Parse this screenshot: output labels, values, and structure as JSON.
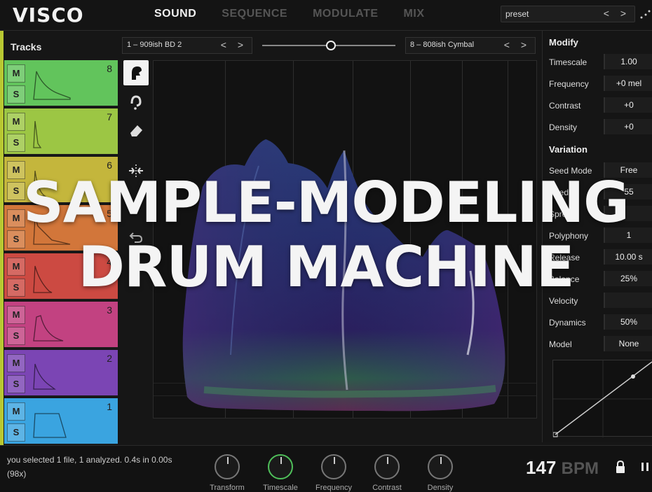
{
  "app": {
    "brand": "VISCO"
  },
  "tabs": [
    {
      "label": "SOUND",
      "active": true
    },
    {
      "label": "SEQUENCE",
      "active": false
    },
    {
      "label": "MODULATE",
      "active": false
    },
    {
      "label": "MIX",
      "active": false
    }
  ],
  "preset": {
    "value": "preset",
    "arrows": "< >"
  },
  "tracks": {
    "title": "Tracks",
    "mute_label": "M",
    "solo_label": "S",
    "items": [
      {
        "number": "8",
        "color": "#62c45c"
      },
      {
        "number": "7",
        "color": "#9cc644"
      },
      {
        "number": "6",
        "color": "#c4b63c"
      },
      {
        "number": "5",
        "color": "#d2763a"
      },
      {
        "number": "4",
        "color": "#cc4a42"
      },
      {
        "number": "3",
        "color": "#c24281"
      },
      {
        "number": "2",
        "color": "#7b45b4"
      },
      {
        "number": "1",
        "color": "#3aa4e0"
      }
    ]
  },
  "samples": {
    "left": {
      "label": "1 – 909ish BD 2",
      "arrows": "< >"
    },
    "right": {
      "label": "8 – 808ish Cymbal",
      "arrows": "< >"
    },
    "morph": 0.52
  },
  "modify": {
    "title": "Modify",
    "rows": [
      {
        "key": "Timescale",
        "value": "1.00"
      },
      {
        "key": "Frequency",
        "value": "+0 mel"
      },
      {
        "key": "Contrast",
        "value": "+0"
      },
      {
        "key": "Density",
        "value": "+0"
      }
    ]
  },
  "variation": {
    "title": "Variation",
    "rows": [
      {
        "key": "Seed Mode",
        "value": "Free"
      },
      {
        "key": "Seed",
        "value": "55"
      },
      {
        "key": "Spread",
        "value": ""
      },
      {
        "key": "Polyphony",
        "value": "1"
      },
      {
        "key": "Release",
        "value": "10.00 s"
      },
      {
        "key": "Balance",
        "value": "25%"
      },
      {
        "key": "Velocity",
        "value": ""
      },
      {
        "key": "Dynamics",
        "value": "50%"
      },
      {
        "key": "Model",
        "value": "None"
      }
    ]
  },
  "status": {
    "text": "you selected 1 file, 1 analyzed. 0.4s in 0.00s (98x)"
  },
  "knobs": [
    {
      "label": "Transform",
      "active": false
    },
    {
      "label": "Timescale",
      "active": true
    },
    {
      "label": "Frequency",
      "active": false
    },
    {
      "label": "Contrast",
      "active": false
    },
    {
      "label": "Density",
      "active": false
    }
  ],
  "tempo": {
    "value": "147",
    "unit": "BPM"
  },
  "overlay": {
    "line1": "SAMPLE-MODELING",
    "line2": "DRUM MACHINE"
  }
}
